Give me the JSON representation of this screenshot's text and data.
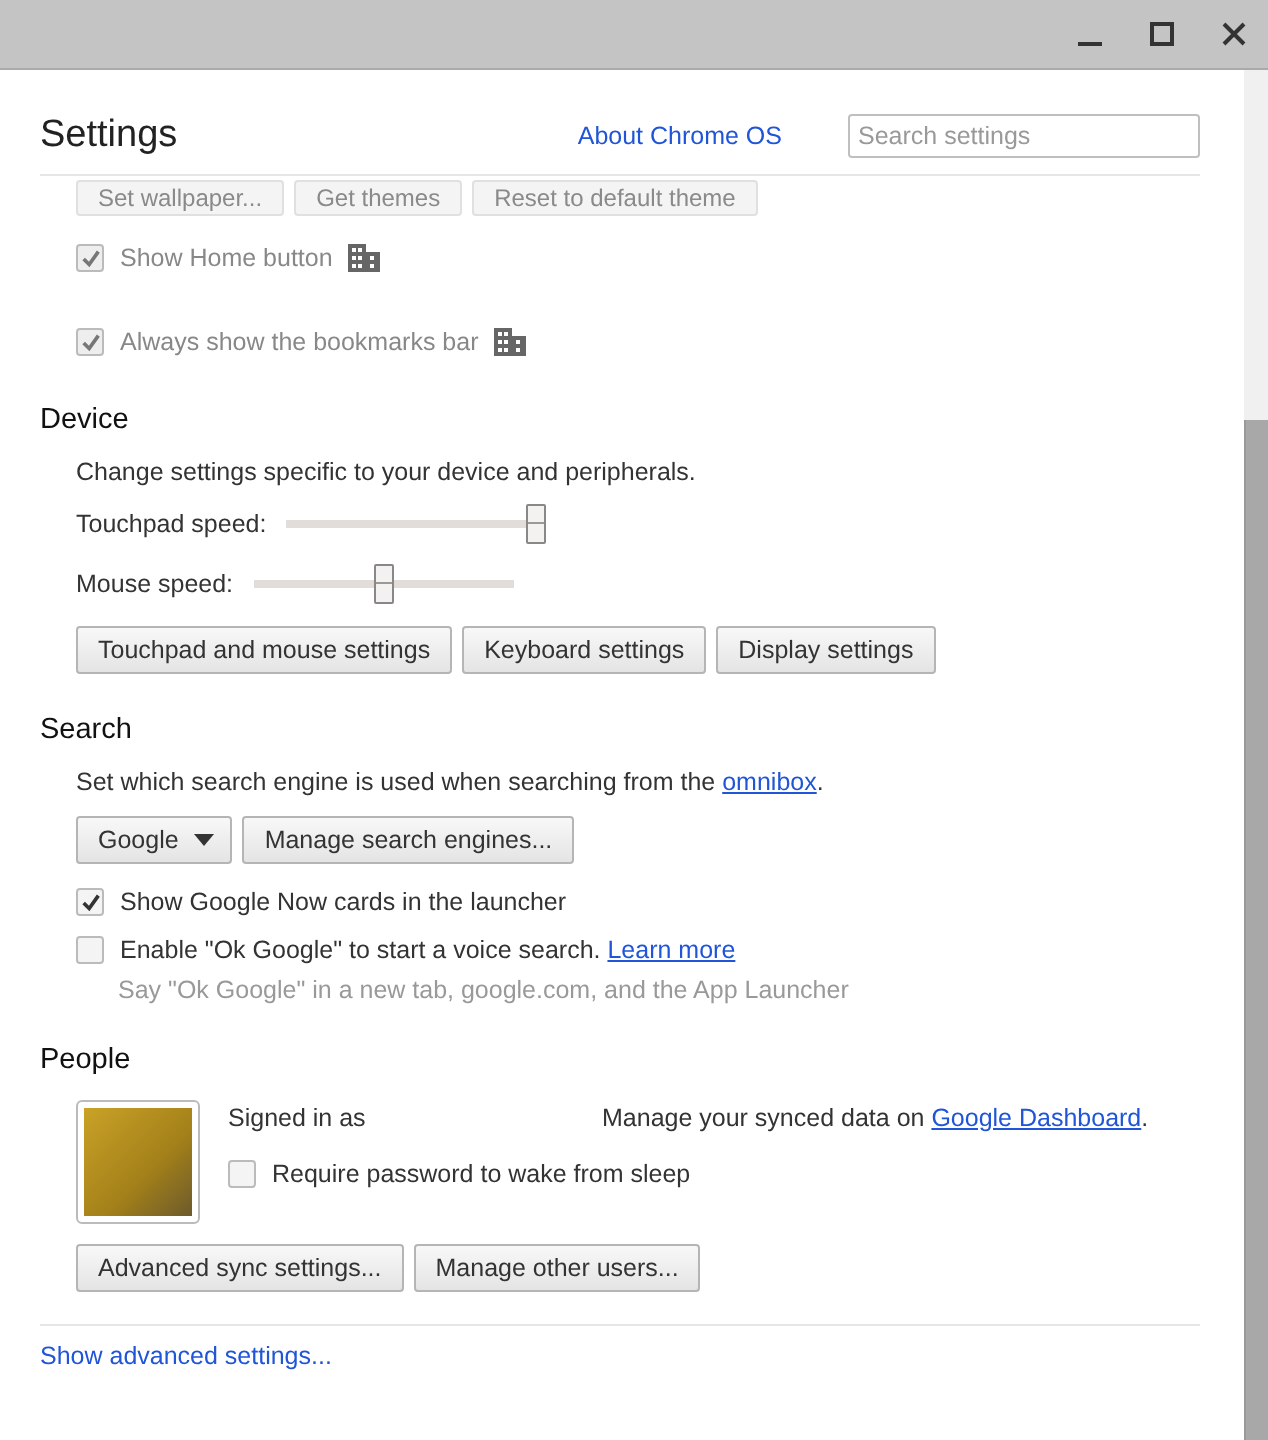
{
  "header": {
    "title": "Settings",
    "about_link": "About Chrome OS",
    "search": {
      "placeholder": "Search settings"
    }
  },
  "appearance_buttons": [
    "Set wallpaper...",
    "Get themes",
    "Reset to default theme"
  ],
  "appearance_options": [
    {
      "label": "Show Home button",
      "checked": true,
      "disabled": true,
      "managed": true
    },
    {
      "label": "Always show the bookmarks bar",
      "checked": true,
      "disabled": true,
      "managed": true
    }
  ],
  "device": {
    "heading": "Device",
    "description": "Change settings specific to your device and peripherals.",
    "sliders": [
      {
        "label": "Touchpad speed:",
        "level": 1.0
      },
      {
        "label": "Mouse speed:",
        "level": 0.5
      }
    ],
    "buttons": [
      "Touchpad and mouse settings",
      "Keyboard settings",
      "Display settings"
    ]
  },
  "search": {
    "heading": "Search",
    "description": "Set which search engine is used when searching from the",
    "description_link": "omnibox",
    "description_end": ".",
    "engine_select": "Google",
    "manage_button": "Manage search engines...",
    "options": [
      {
        "label": "Show Google Now cards in the launcher",
        "checked": true
      },
      {
        "label": "Enable \"Ok Google\" to start a voice search.",
        "link": "Learn more",
        "hint": "Say \"Ok Google\" in a new tab, google.com, and the App Launcher",
        "checked": false
      }
    ]
  },
  "people": {
    "heading": "People",
    "signed_in": "Signed in as",
    "sync_text": "Manage your synced data on",
    "sync_link": "Google Dashboard",
    "sync_end": ".",
    "require_password": {
      "label": "Require password to wake from sleep",
      "checked": false
    },
    "buttons": [
      "Advanced sync settings...",
      "Manage other users..."
    ]
  },
  "show_advanced": "Show advanced settings..."
}
